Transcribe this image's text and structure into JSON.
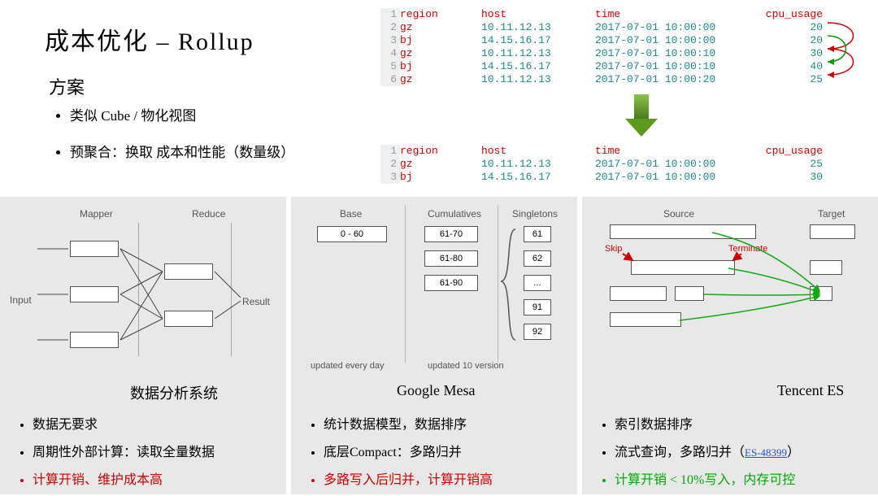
{
  "title": "成本优化 – Rollup",
  "subhead": "方案",
  "top_bullets": [
    "类似 Cube / 物化视图",
    "预聚合：换取 成本和性能（数量级）"
  ],
  "table_headers": [
    "region",
    "host",
    "time",
    "cpu_usage"
  ],
  "table1_rows": [
    {
      "ln": "2",
      "region": "gz",
      "host": "10.11.12.13",
      "time": "2017-07-01 10:00:00",
      "cpu": "20"
    },
    {
      "ln": "3",
      "region": "bj",
      "host": "14.15.16.17",
      "time": "2017-07-01 10:00:00",
      "cpu": "20"
    },
    {
      "ln": "4",
      "region": "gz",
      "host": "10.11.12.13",
      "time": "2017-07-01 10:00:10",
      "cpu": "30"
    },
    {
      "ln": "5",
      "region": "bj",
      "host": "14.15.16.17",
      "time": "2017-07-01 10:00:10",
      "cpu": "40"
    },
    {
      "ln": "6",
      "region": "gz",
      "host": "10.11.12.13",
      "time": "2017-07-01 10:00:20",
      "cpu": "25"
    }
  ],
  "table2_rows": [
    {
      "ln": "2",
      "region": "gz",
      "host": "10.11.12.13",
      "time": "2017-07-01 10:00:00",
      "cpu": "25"
    },
    {
      "ln": "3",
      "region": "bj",
      "host": "14.15.16.17",
      "time": "2017-07-01 10:00:00",
      "cpu": "30"
    }
  ],
  "panel1": {
    "title": "数据分析系统",
    "labels": {
      "mapper": "Mapper",
      "reduce": "Reduce",
      "input": "Input",
      "result": "Result"
    },
    "bullets": [
      {
        "text": "数据无要求",
        "cls": ""
      },
      {
        "text": "周期性外部计算：读取全量数据",
        "cls": ""
      },
      {
        "text": "计算开销、维护成本高",
        "cls": "txt-red"
      }
    ]
  },
  "panel2": {
    "title": "Google Mesa",
    "labels": {
      "base": "Base",
      "cum": "Cumulatives",
      "sin": "Singletons",
      "uev": "updated every day",
      "u10": "updated 10 version"
    },
    "base": "0 - 60",
    "cumulatives": [
      "61-70",
      "61-80",
      "61-90"
    ],
    "singletons": [
      "61",
      "62",
      "...",
      "91",
      "92"
    ],
    "bullets": [
      {
        "text": "统计数据模型，数据排序",
        "cls": ""
      },
      {
        "text": "底层Compact：多路归并",
        "cls": ""
      },
      {
        "text": "多路写入后归并，计算开销高",
        "cls": "txt-red"
      }
    ]
  },
  "panel3": {
    "title": "Tencent ES",
    "labels": {
      "src": "Source",
      "tgt": "Target",
      "skip": "Skip",
      "term": "Terminate"
    },
    "link_text": "ES-48399",
    "bullets": [
      {
        "pre": "索引数据排序",
        "link": "",
        "post": "",
        "cls": ""
      },
      {
        "pre": "流式查询，多路归并（",
        "link": "ES-48399",
        "post": "）",
        "cls": ""
      },
      {
        "pre": "计算开销 < 10%写入，内存可控",
        "link": "",
        "post": "",
        "cls": "txt-green"
      }
    ]
  }
}
